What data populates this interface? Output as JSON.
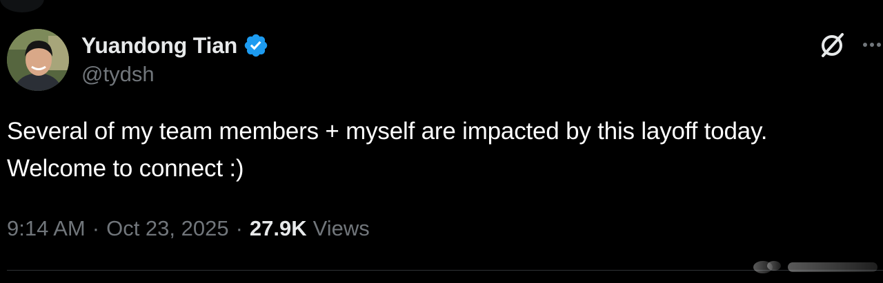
{
  "author": {
    "display_name": "Yuandong Tian",
    "handle": "@tydsh",
    "verified": true
  },
  "tweet": {
    "lines": [
      "Several of my team members + myself are impacted by this layoff today.",
      "Welcome to connect :)"
    ]
  },
  "meta": {
    "time": "9:14 AM",
    "separator": "·",
    "date": "Oct 23, 2025",
    "views_count": "27.9K",
    "views_label": "Views"
  },
  "icons": {
    "verified": "verified-badge-icon",
    "grok": "grok-icon",
    "more": "more-horizontal-icon"
  },
  "colors": {
    "background": "#000000",
    "primary_text": "#e7e9ea",
    "secondary_text": "#71767b",
    "verified_blue": "#1d9bf0",
    "divider": "#2f3336"
  }
}
